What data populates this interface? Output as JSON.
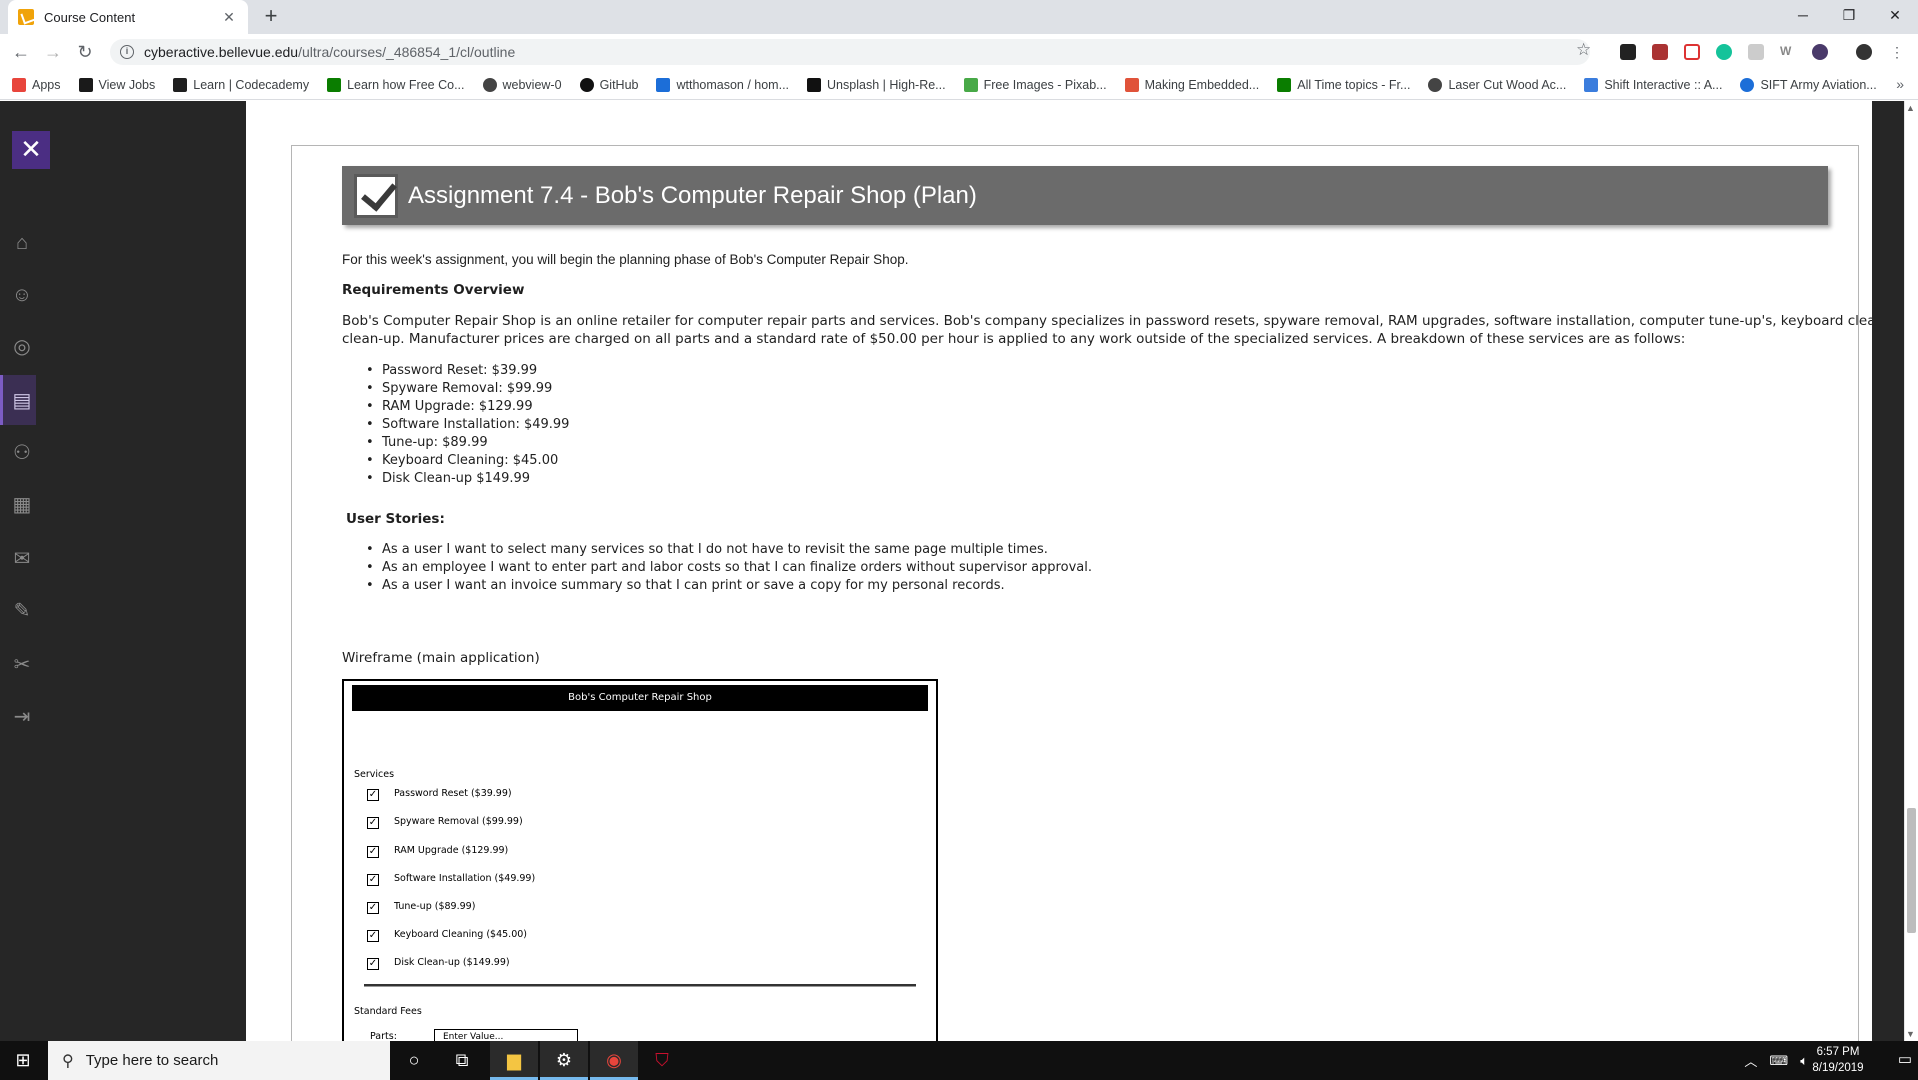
{
  "browser": {
    "tab_title": "Course Content",
    "tab_close": "✕",
    "new_tab": "+",
    "url_host": "cyberactive.bellevue.edu",
    "url_path": "/ultra/courses/_486854_1/cl/outline",
    "window_minimize": "─",
    "window_restore": "❐",
    "window_close": "✕"
  },
  "bookmarks": [
    {
      "label": "Apps",
      "color": "#e8453c"
    },
    {
      "label": "View Jobs",
      "color": "#1a1a1a"
    },
    {
      "label": "Learn | Codecademy",
      "color": "#1f1f1f"
    },
    {
      "label": "Learn how Free Co...",
      "color": "#0a7d00"
    },
    {
      "label": "webview-0",
      "color": "#444444"
    },
    {
      "label": "GitHub",
      "color": "#111111"
    },
    {
      "label": "wtthomason / hom...",
      "color": "#1c6ed8"
    },
    {
      "label": "Unsplash | High-Re...",
      "color": "#111111"
    },
    {
      "label": "Free Images - Pixab...",
      "color": "#48a947"
    },
    {
      "label": "Making Embedded...",
      "color": "#e0533a"
    },
    {
      "label": "All Time topics - Fr...",
      "color": "#0a7d00"
    },
    {
      "label": "Laser Cut Wood Ac...",
      "color": "#444444"
    },
    {
      "label": "Shift Interactive :: A...",
      "color": "#3b7ddd"
    },
    {
      "label": "SIFT Army Aviation...",
      "color": "#1c6ed8"
    }
  ],
  "bookmarks_more": "»",
  "left_rail": {
    "close": "✕"
  },
  "assignment": {
    "title": "Assignment 7.4 - Bob's Computer Repair Shop (Plan)",
    "intro": "For this week's assignment, you will begin the planning phase of Bob's Computer Repair Shop.",
    "req_heading": "Requirements Overview",
    "req_line1": "Bob's Computer Repair Shop is an online retailer for computer repair parts and services. Bob's company specializes in password resets, spyware removal, RAM upgrades, software installation, computer tune-up's, keyboard cleaning, and disk",
    "req_line2": "clean-up. Manufacturer prices are charged on all parts and a standard rate of $50.00 per hour is applied to any work outside of the specialized services.  A breakdown of these services are as follows:",
    "services": [
      " Password Reset: $39.99",
      "Spyware Removal: $99.99",
      "RAM Upgrade: $129.99",
      "Software Installation: $49.99",
      "Tune-up: $89.99",
      "Keyboard Cleaning: $45.00",
      "Disk Clean-up $149.99"
    ],
    "stories_heading": "User Stories:",
    "stories": [
      "As a user I want to select many services so that I do not have to revisit the same page multiple times.",
      "As an employee I want to enter part and labor costs so that I can finalize orders without supervisor approval.",
      "As a user I want an invoice summary so that I can print or save a copy for my personal records."
    ],
    "wireframe_caption": "Wireframe (main application)"
  },
  "wireframe": {
    "title": "Bob's Computer Repair Shop",
    "services_label": "Services",
    "items": [
      "Password Reset ($39.99)",
      "Spyware Removal ($99.99)",
      "RAM Upgrade ($129.99)",
      "Software Installation ($49.99)",
      "Tune-up ($89.99)",
      "Keyboard Cleaning ($45.00)",
      "Disk Clean-up ($149.99)"
    ],
    "check": "✓",
    "fees_label": "Standard Fees",
    "parts_label": "Parts:",
    "parts_placeholder": "Enter Value..."
  },
  "taskbar": {
    "search_placeholder": "Type here to search",
    "time": "6:57 PM",
    "date": "8/19/2019",
    "notification_count": "1"
  }
}
